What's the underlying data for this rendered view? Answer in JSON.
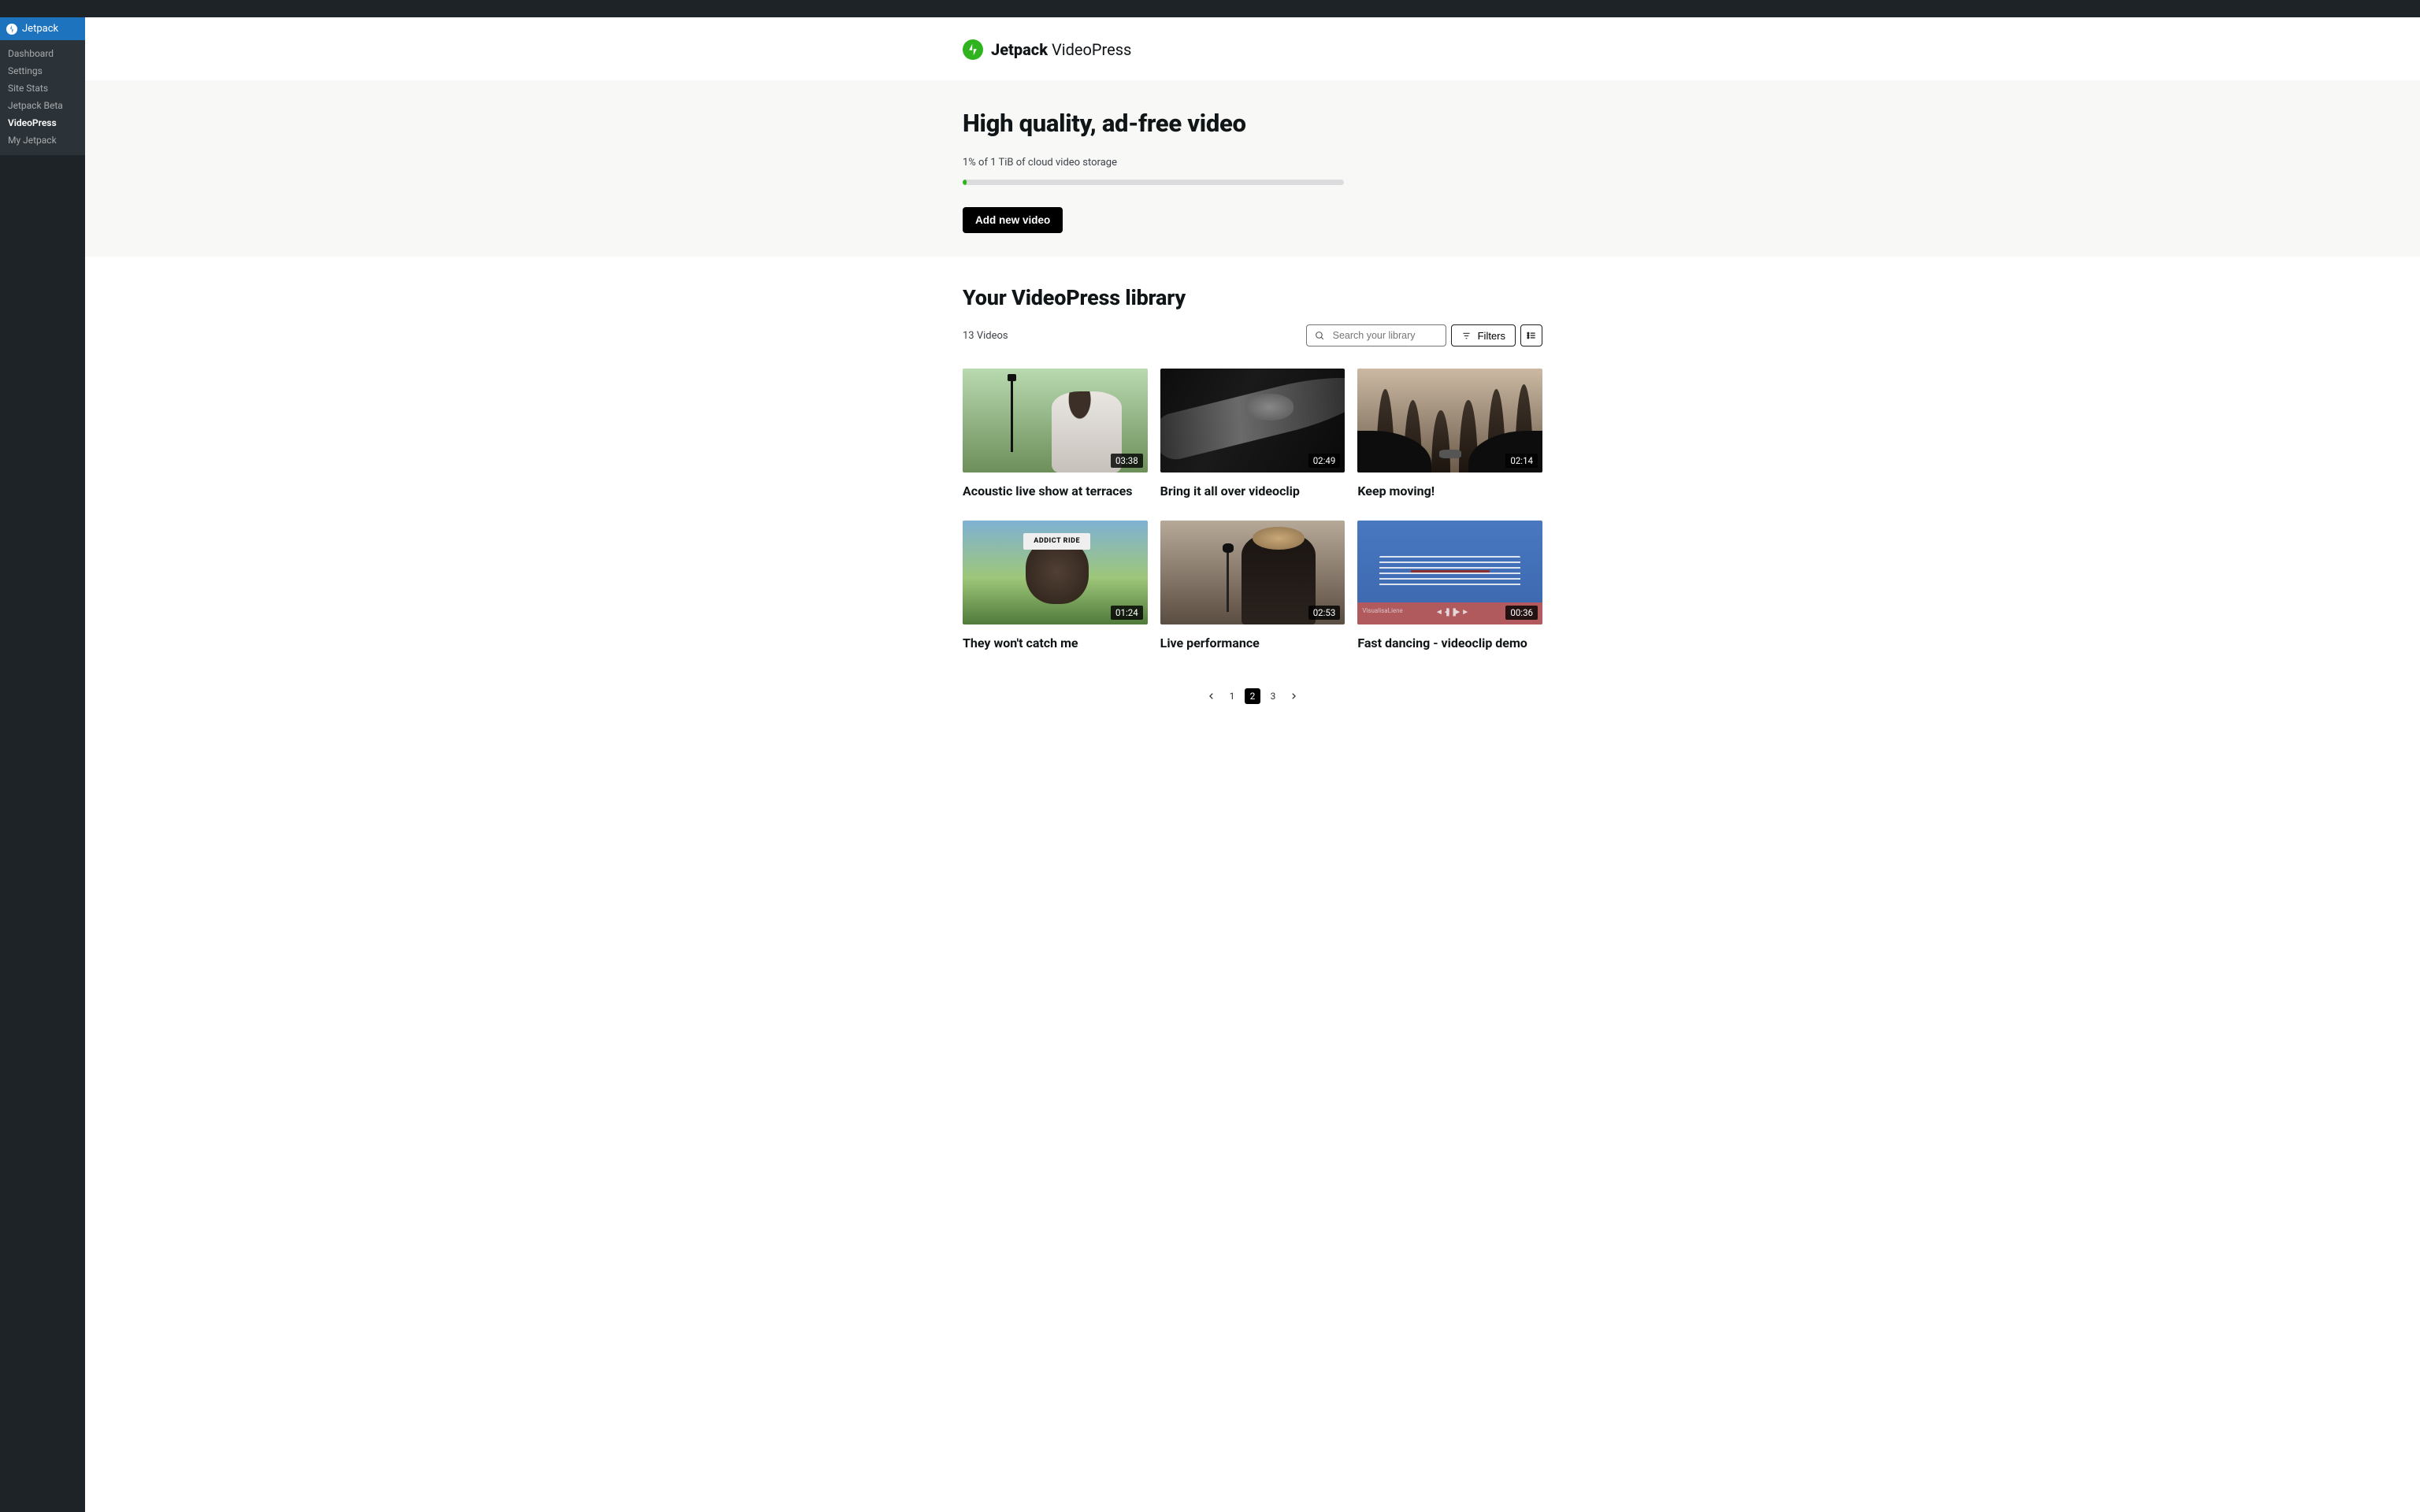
{
  "sidebar": {
    "jetpack_label": "Jetpack",
    "items": [
      {
        "label": "Dashboard",
        "active": false
      },
      {
        "label": "Settings",
        "active": false
      },
      {
        "label": "Site Stats",
        "active": false
      },
      {
        "label": "Jetpack Beta",
        "active": false
      },
      {
        "label": "VideoPress",
        "active": true
      },
      {
        "label": "My Jetpack",
        "active": false
      }
    ]
  },
  "brand": {
    "strong": "Jetpack",
    "light": "VideoPress"
  },
  "hero": {
    "title": "High quality, ad-free video",
    "storage_line": "1% of 1 TiB of cloud video storage",
    "progress_percent": 1,
    "add_button": "Add new video"
  },
  "library": {
    "title": "Your VideoPress library",
    "count_text": "13 Videos",
    "search_placeholder": "Search your library",
    "filters_label": "Filters"
  },
  "videos": [
    {
      "title": "Acoustic live show at terraces",
      "duration": "03:38"
    },
    {
      "title": "Bring it all over videoclip",
      "duration": "02:49"
    },
    {
      "title": "Keep moving!",
      "duration": "02:14"
    },
    {
      "title": "They won't catch me",
      "duration": "01:24"
    },
    {
      "title": "Live performance",
      "duration": "02:53"
    },
    {
      "title": "Fast dancing - videoclip demo",
      "duration": "00:36"
    }
  ],
  "pagination": {
    "pages": [
      "1",
      "2",
      "3"
    ],
    "current": "2"
  },
  "thumb_labels": {
    "addict_ride": "ADDICT RIDE",
    "visual_text": "VisualisaLiene"
  }
}
